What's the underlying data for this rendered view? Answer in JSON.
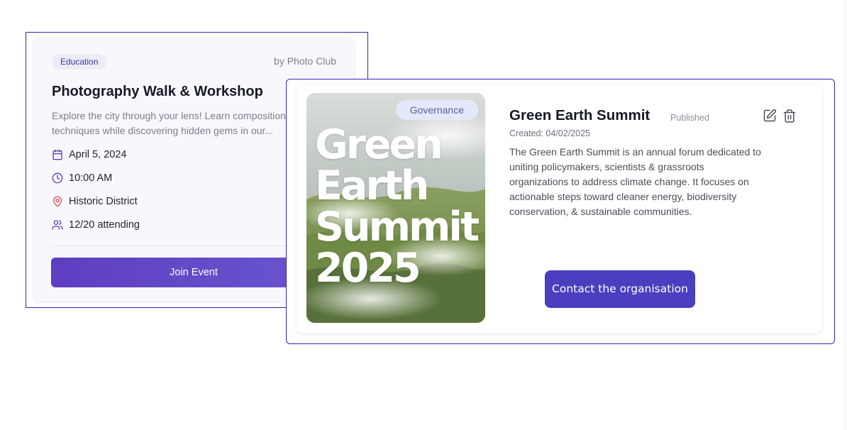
{
  "event_card": {
    "category": "Education",
    "organizer": "by Photo Club",
    "title": "Photography Walk & Workshop",
    "description_lines": [
      "Explore the city through your lens! Learn composition",
      "techniques while discovering hidden gems in our..."
    ],
    "date": "April 5, 2024",
    "time": "10:00 AM",
    "location": "Historic District",
    "attendance": "12/20 attending",
    "join_label": "Join Event",
    "icons": {
      "date": "calendar-icon",
      "time": "clock-icon",
      "location": "map-pin-icon",
      "attendance": "users-icon"
    },
    "accent_color": "#5b3fc0"
  },
  "summit_card": {
    "poster": {
      "badge": "Governance",
      "lines": [
        "Green",
        "Earth",
        "Summit",
        "2025"
      ]
    },
    "title": "Green Earth Summit",
    "status": "Published",
    "created": "Created: 04/02/2025",
    "description_lines": [
      "The Green Earth Summit is an annual forum dedicated to",
      "uniting policymakers, scientists & grassroots",
      "organizations to address climate change. It focuses on",
      "actionable steps toward cleaner energy, biodiversity",
      "conservation, & sustainable communities."
    ],
    "contact_label": "Contact the organisation",
    "icons": {
      "edit": "edit-icon",
      "delete": "trash-icon"
    },
    "button_color": "#4a3fbf"
  }
}
